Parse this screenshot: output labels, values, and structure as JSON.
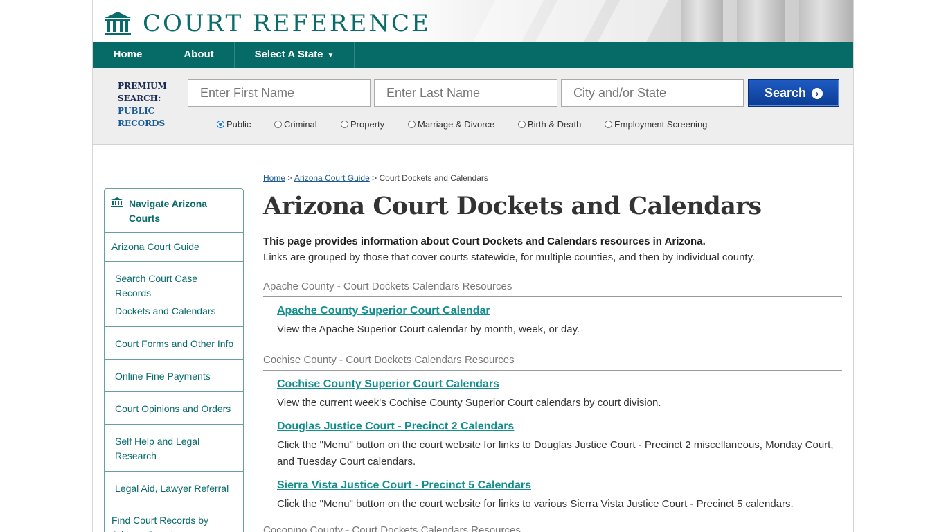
{
  "header": {
    "logo_text": "COURT REFERENCE",
    "logo_icon": "courthouse-icon"
  },
  "nav": {
    "items": [
      {
        "label": "Home"
      },
      {
        "label": "About"
      },
      {
        "label": "Select A State",
        "caret": "▼"
      }
    ]
  },
  "search": {
    "premium_line1": "PREMIUM",
    "premium_line2": "SEARCH:",
    "premium_line3": "PUBLIC",
    "premium_line4": "RECORDS",
    "first_name_placeholder": "Enter First Name",
    "last_name_placeholder": "Enter Last Name",
    "city_state_placeholder": "City and/or State",
    "button_label": "Search",
    "button_icon": "chevron-right-icon",
    "options": [
      {
        "label": "Public",
        "checked": true
      },
      {
        "label": "Criminal",
        "checked": false
      },
      {
        "label": "Property",
        "checked": false
      },
      {
        "label": "Marriage & Divorce",
        "checked": false
      },
      {
        "label": "Birth & Death",
        "checked": false
      },
      {
        "label": "Employment Screening",
        "checked": false
      }
    ]
  },
  "sidebar": {
    "heading": "Navigate Arizona Courts",
    "heading_icon": "courthouse-icon",
    "items": [
      {
        "label": "Arizona Court Guide"
      },
      {
        "label": "Search Court Case Records"
      },
      {
        "label": "Dockets and Calendars"
      },
      {
        "label": "Court Forms and Other Info"
      },
      {
        "label": "Online Fine Payments"
      },
      {
        "label": "Court Opinions and Orders"
      },
      {
        "label": "Self Help and Legal Research"
      },
      {
        "label": "Legal Aid, Lawyer Referral"
      },
      {
        "label": "Find Court Records by Arizona County"
      }
    ]
  },
  "breadcrumb": {
    "home": "Home",
    "sep": ">",
    "guide": "Arizona Court Guide",
    "current": "Court Dockets and Calendars"
  },
  "main": {
    "title": "Arizona Court Dockets and Calendars",
    "intro_bold": "This page provides information about Court Dockets and Calendars resources in Arizona.",
    "intro": "Links are grouped by those that cover courts statewide, for multiple counties, and then by individual county.",
    "sections": [
      {
        "heading": "Apache County - Court Dockets Calendars Resources",
        "resources": [
          {
            "title": "Apache County Superior Court Calendar",
            "desc": "View the Apache Superior Court calendar by month, week, or day."
          }
        ]
      },
      {
        "heading": "Cochise County - Court Dockets Calendars Resources",
        "resources": [
          {
            "title": "Cochise County Superior Court Calendars",
            "desc": "View the current week's Cochise County Superior Court calendars by court division."
          },
          {
            "title": "Douglas Justice Court - Precinct 2 Calendars",
            "desc": "Click the \"Menu\" button on the court website for links to Douglas Justice Court - Precinct 2 miscellaneous, Monday Court, and Tuesday Court calendars."
          },
          {
            "title": "Sierra Vista Justice Court - Precinct 5 Calendars",
            "desc": "Click the \"Menu\" button on the court website for links to various Sierra Vista Justice Court - Precinct 5 calendars."
          }
        ]
      },
      {
        "heading": "Coconino County - Court Dockets Calendars Resources",
        "resources": []
      }
    ]
  },
  "colors": {
    "brand_teal": "#066a67",
    "link_teal": "#128f8f",
    "search_blue": "#0b3c93"
  }
}
